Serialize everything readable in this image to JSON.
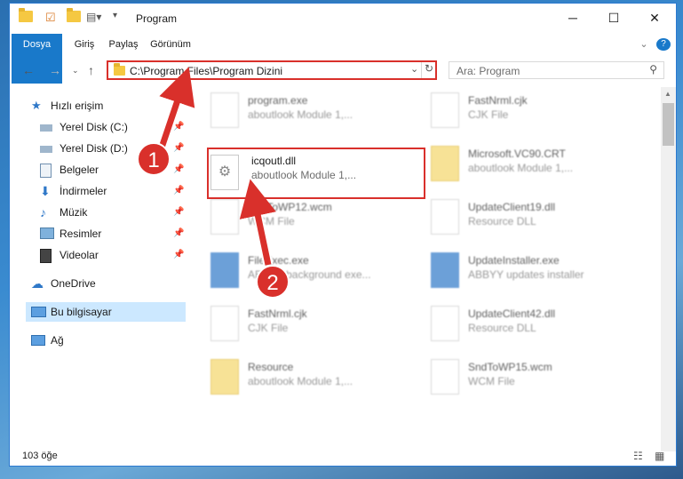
{
  "window": {
    "title": "Program",
    "controls": {
      "minimize": "─",
      "maximize": "☐",
      "close": "✕"
    }
  },
  "ribbon": {
    "tabs": [
      "Dosya",
      "Giriş",
      "Paylaş",
      "Görünüm"
    ]
  },
  "address": {
    "path": "C:\\Program Files\\Program Dizini"
  },
  "search": {
    "placeholder": "Ara: Program"
  },
  "nav": {
    "quick_access": "Hızlı erişim",
    "items": [
      "Yerel Disk (C:)",
      "Yerel Disk (D:)",
      "Belgeler",
      "İndirmeler",
      "Müzik",
      "Resimler",
      "Videolar"
    ],
    "onedrive": "OneDrive",
    "this_pc": "Bu bilgisayar",
    "network": "Ağ"
  },
  "files": [
    {
      "name": "program.exe",
      "desc": "aboutlook Module 1,..."
    },
    {
      "name": "FastNrml.cjk",
      "desc": "CJK File"
    },
    {
      "name": "icqoutl.dll",
      "desc": "aboutlook Module 1,..."
    },
    {
      "name": "Microsoft.VC90.CRT",
      "desc": "aboutlook Module 1,..."
    },
    {
      "name": "SndToWP12.wcm",
      "desc": "WCM File"
    },
    {
      "name": "UpdateClient19.dll",
      "desc": "Resource DLL"
    },
    {
      "name": "FileExec.exe",
      "desc": "ABBYY background exe..."
    },
    {
      "name": "UpdateInstaller.exe",
      "desc": "ABBYY updates installer"
    },
    {
      "name": "FastNrml.cjk",
      "desc": "CJK File"
    },
    {
      "name": "UpdateClient42.dll",
      "desc": "Resource DLL"
    },
    {
      "name": "Resource",
      "desc": "aboutlook Module 1,..."
    },
    {
      "name": "SndToWP15.wcm",
      "desc": "WCM File"
    }
  ],
  "status": {
    "count": "103 öğe"
  },
  "steps": [
    "1",
    "2"
  ],
  "colors": {
    "accent": "#1979ca",
    "highlight": "#d9302b",
    "selected": "#cce8ff"
  }
}
